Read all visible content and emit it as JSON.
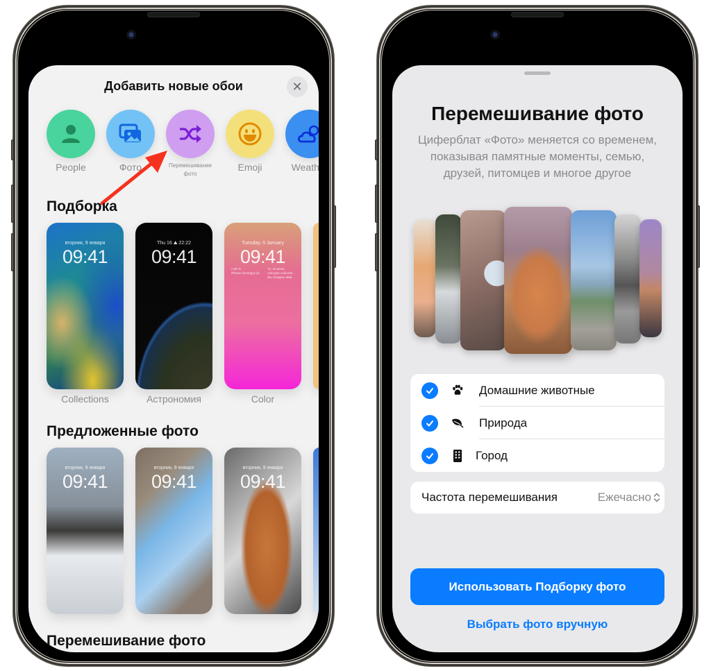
{
  "left_screen": {
    "sheet_title": "Добавить новые обои",
    "close_label": "✕",
    "categories": [
      {
        "label": "People",
        "icon": "person-icon",
        "color": "#48d49c"
      },
      {
        "label": "Фото",
        "icon": "photos-icon",
        "color": "#72c2f6"
      },
      {
        "label": "Перемешивание фото",
        "icon": "shuffle-icon",
        "color": "#cf9ef0"
      },
      {
        "label": "Emoji",
        "icon": "smiley-icon",
        "color": "#f4e07a"
      },
      {
        "label": "Weather",
        "icon": "weather-icon",
        "color": "#3a8ff0"
      }
    ],
    "sections": {
      "featured": {
        "title": "Подборка",
        "items": [
          {
            "label": "Collections",
            "date": "вторник, 9 января",
            "time": "09:41"
          },
          {
            "label": "Астрономия",
            "date": "Thu 16  ⛰  22:22",
            "time": "09:41"
          },
          {
            "label": "Color",
            "date": "Tuesday, 9 January",
            "time": "09:41",
            "widget_left": [
              "▯ 98 %",
              "iPhone (Georgiy) (2)"
            ],
            "widget_right": [
              "Чт, 18 июня",
              "Сегодня события…",
              "Вы сегодня свой…"
            ]
          }
        ]
      },
      "suggested": {
        "title": "Предложенные фото",
        "items": [
          {
            "date": "вторник, 9 января",
            "time": "09:41"
          },
          {
            "date": "вторник, 9 января",
            "time": "09:41"
          },
          {
            "date": "вторник, 9 января",
            "time": "09:41"
          }
        ]
      },
      "shuffle": {
        "title": "Перемешивание фото"
      }
    }
  },
  "right_screen": {
    "title": "Перемешивание фото",
    "description": "Циферблат «Фото» меняется со временем, показывая памятные моменты, семью, друзей, питомцев и многое другое",
    "options": [
      {
        "label": "Домашние животные",
        "icon": "paw-icon",
        "checked": true
      },
      {
        "label": "Природа",
        "icon": "leaf-icon",
        "checked": true
      },
      {
        "label": "Город",
        "icon": "building-icon",
        "checked": true
      }
    ],
    "frequency": {
      "label": "Частота перемешивания",
      "value": "Ежечасно"
    },
    "primary_button": "Использовать Подборку фото",
    "secondary_link": "Выбрать фото вручную"
  },
  "colors": {
    "accent_blue": "#0a7cff",
    "annotation_arrow": "#f5321e",
    "shuffle_purple": "#7a1fd6"
  }
}
